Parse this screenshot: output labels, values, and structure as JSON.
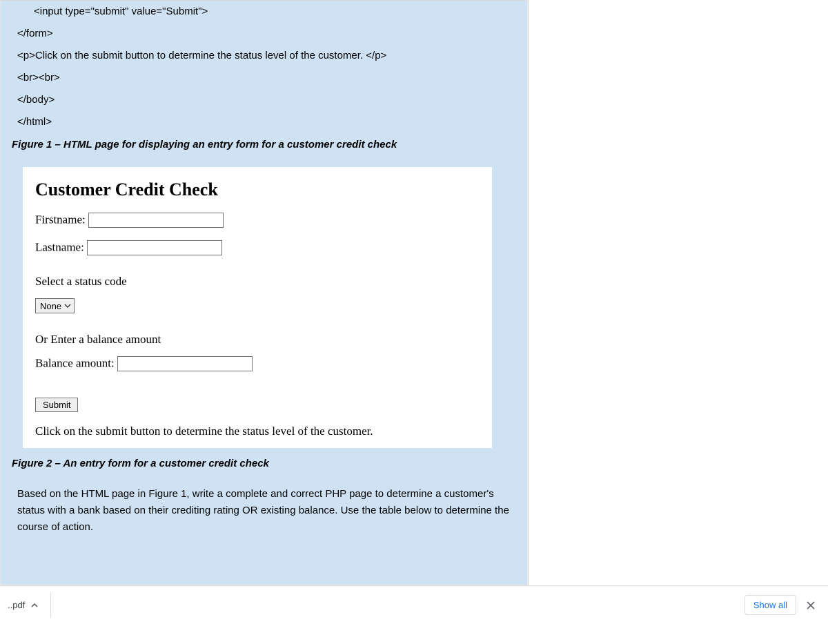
{
  "code": {
    "line1": "<input type=\"submit\" value=\"Submit\">",
    "line2": "</form>",
    "line3": "<p>Click on the submit button to determine the status level of the customer. </p>",
    "line4": "<br><br>",
    "line5": "</body>",
    "line6": "</html>"
  },
  "figure1_caption": "Figure 1 – HTML page for displaying an entry form for a customer credit check",
  "form": {
    "heading": "Customer Credit Check",
    "firstname_label": "Firstname:",
    "lastname_label": "Lastname:",
    "select_caption": "Select a status code",
    "select_value": "None",
    "or_caption": "Or Enter a balance amount",
    "balance_label": "Balance amount:",
    "submit_label": "Submit",
    "instruction": "Click on the submit button to determine the status level of the customer."
  },
  "figure2_caption": "Figure 2 – An entry form for a customer credit check",
  "body_paragraph": "Based on the HTML page in Figure 1, write a complete and correct PHP page to determine a customer's status with a bank based on their crediting rating OR existing balance. Use the table below to determine the course of action.",
  "download_bar": {
    "filename": "..pdf",
    "show_all": "Show all"
  }
}
